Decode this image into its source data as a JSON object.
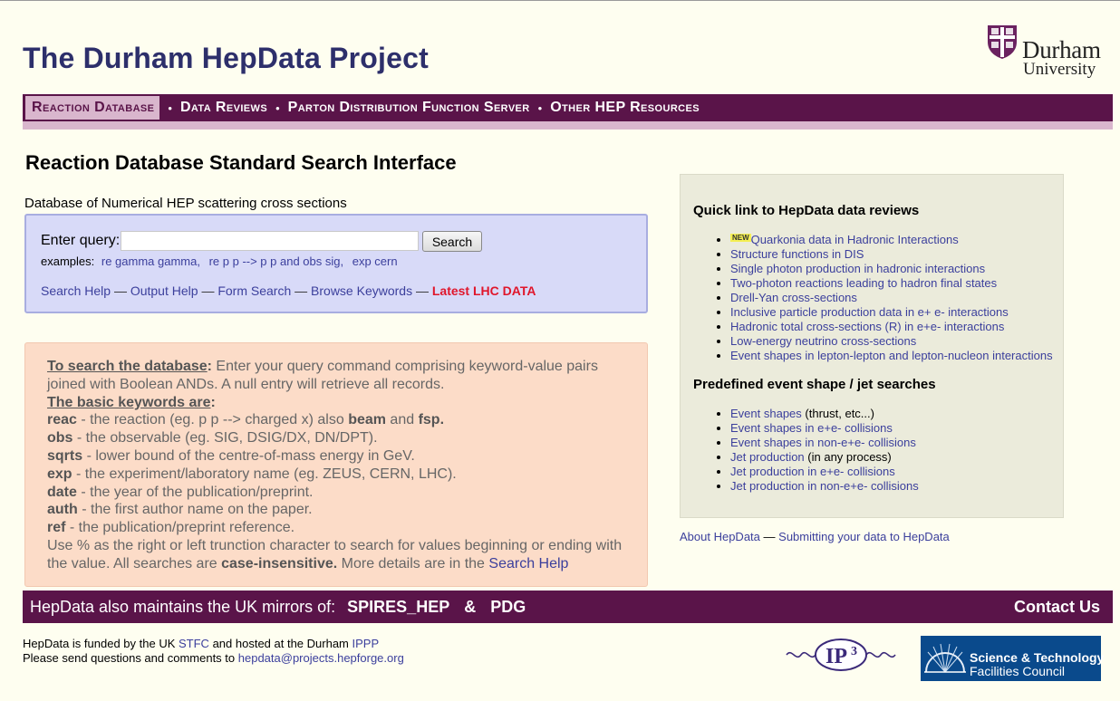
{
  "site": {
    "title": "The Durham HepData Project",
    "logo_line1": "Durham",
    "logo_line2": "University"
  },
  "nav": {
    "items": [
      {
        "label": "Reaction Database"
      },
      {
        "label": "Data Reviews"
      },
      {
        "label": "Parton Distribution Function Server"
      },
      {
        "label": "Other HEP Resources"
      }
    ],
    "separator": "•"
  },
  "main": {
    "heading": "Reaction Database Standard Search Interface",
    "description": "Database of Numerical HEP scattering cross sections"
  },
  "search": {
    "label": "Enter query:",
    "value": "",
    "button": "Search",
    "examples_label": "examples:",
    "examples": [
      "re gamma gamma,",
      "re p p --> p p and obs sig,",
      "exp cern"
    ],
    "help_links": [
      "Search Help",
      "Output Help",
      "Form Search",
      "Browse Keywords",
      "Latest LHC DATA"
    ],
    "dash": "—"
  },
  "info": {
    "search_title": "To search the database",
    "colon": ":",
    "search_text": " Enter your query command comprising keyword-value pairs joined with Boolean ANDs. A null entry will retrieve all records.",
    "keywords_title": "The basic keywords are",
    "keywords": [
      {
        "key": "reac",
        "desc": " - the reaction (eg. p p --> charged x) also ",
        "extra1": "beam",
        "mid": " and ",
        "extra2": "fsp."
      },
      {
        "key": "obs",
        "desc": " - the observable (eg. SIG, DSIG/DX, DN/DPT)."
      },
      {
        "key": "sqrts",
        "desc": " - lower bound of the centre-of-mass energy in GeV."
      },
      {
        "key": "exp",
        "desc": " - the experiment/laboratory name (eg. ZEUS, CERN, LHC)."
      },
      {
        "key": "date",
        "desc": " - the year of the publication/preprint."
      },
      {
        "key": "auth",
        "desc": " - the first author name on the paper."
      },
      {
        "key": "ref",
        "desc": " - the publication/preprint reference."
      }
    ],
    "footer_text": "Use % as the right or left trunction character to search for values beginning or ending with the value. All searches are ",
    "footer_bold": "case-insensitive.",
    "footer_text2": " More details are in the ",
    "footer_link": "Search Help"
  },
  "quicklinks": {
    "reviews_title": "Quick link to HepData data reviews",
    "new_badge": "NEW",
    "reviews": [
      "Quarkonia data in Hadronic Interactions",
      "Structure functions in DIS",
      "Single photon production in hadronic interactions",
      "Two-photon reactions leading to hadron final states",
      "Drell-Yan cross-sections",
      "Inclusive particle production data in e+ e- interactions",
      "Hadronic total cross-sections (R) in e+e- interactions",
      "Low-energy neutrino cross-sections",
      "Event shapes in lepton-lepton and lepton-nucleon interactions"
    ],
    "events_title": "Predefined event shape / jet searches",
    "events": [
      {
        "link": "Event shapes",
        "note": " (thrust, etc...)"
      },
      {
        "link": "Event shapes in e+e- collisions",
        "note": ""
      },
      {
        "link": "Event shapes in non-e+e- collisions",
        "note": ""
      },
      {
        "link": "Jet production",
        "note": " (in any process)"
      },
      {
        "link": "Jet production in e+e- collisions",
        "note": ""
      },
      {
        "link": "Jet production in non-e+e- collisions",
        "note": ""
      }
    ]
  },
  "about": {
    "about_link": "About HepData",
    "dash": "—",
    "submit_link": "Submitting your data to HepData"
  },
  "footer": {
    "mirrors_text": "HepData also maintains the UK mirrors of:",
    "mirror1": "SPIRES_HEP",
    "amp": "&",
    "mirror2": "PDG",
    "contact": "Contact Us"
  },
  "credits": {
    "line1_a": "HepData is funded by the UK ",
    "line1_link1": "STFC",
    "line1_b": " and hosted at the Durham ",
    "line1_link2": "IPPP",
    "line2_a": "Please send questions and comments to ",
    "line2_link": "hepdata@projects.hepforge.org"
  },
  "partners": {
    "ippp_logo_text": "IP",
    "ippp_logo_sup": "3",
    "stfc_line1": "Science & Technology",
    "stfc_line2": "Facilities Council"
  },
  "colors": {
    "page_bg": "#fefef0",
    "title": "#2d2f6b",
    "nav_bg": "#5a1449",
    "nav_active_bg": "#d9b6cd",
    "link": "#3b3f9c",
    "lhc_link": "#e0162b",
    "search_box_bg": "#d8daf8",
    "info_box_bg": "#fcdcc8",
    "quick_box_bg": "#ebebdb",
    "stfc_bg": "#0a4a8c"
  }
}
